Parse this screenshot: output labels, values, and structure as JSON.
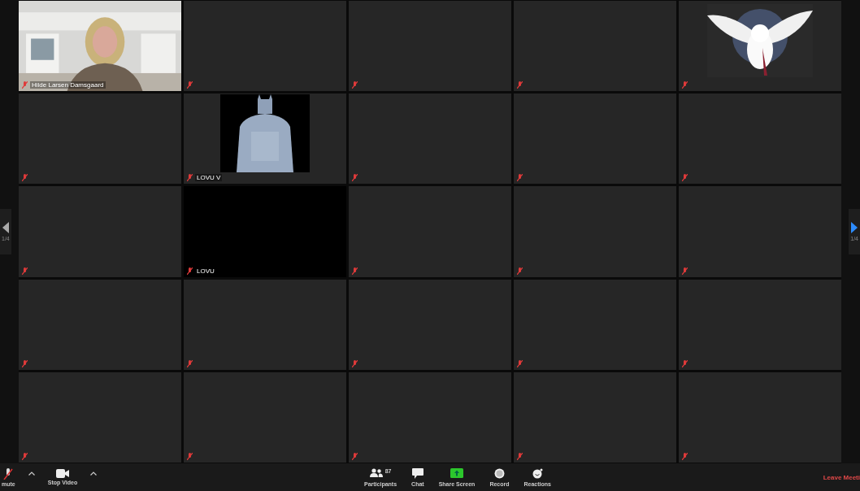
{
  "pager": {
    "left_label": "1/4",
    "right_label": "1/4"
  },
  "tiles": [
    {
      "kind": "video",
      "name": "Hilde Larsen Damsgaard",
      "muted": true
    },
    {
      "kind": "empty",
      "muted": true
    },
    {
      "kind": "empty",
      "muted": true
    },
    {
      "kind": "empty",
      "muted": true
    },
    {
      "kind": "avatar",
      "muted": true
    },
    {
      "kind": "empty",
      "muted": true
    },
    {
      "kind": "avatar",
      "name": "LOVU V",
      "muted": true
    },
    {
      "kind": "empty",
      "muted": true
    },
    {
      "kind": "empty",
      "muted": true
    },
    {
      "kind": "empty",
      "muted": true
    },
    {
      "kind": "empty",
      "muted": true
    },
    {
      "kind": "black",
      "name": "LOVU",
      "muted": true
    },
    {
      "kind": "empty",
      "muted": true
    },
    {
      "kind": "empty",
      "muted": true
    },
    {
      "kind": "empty",
      "muted": true
    },
    {
      "kind": "empty",
      "muted": true
    },
    {
      "kind": "empty",
      "muted": true
    },
    {
      "kind": "empty",
      "muted": true
    },
    {
      "kind": "empty",
      "muted": true
    },
    {
      "kind": "empty",
      "muted": true
    },
    {
      "kind": "empty",
      "muted": true
    },
    {
      "kind": "empty",
      "muted": true
    },
    {
      "kind": "empty",
      "muted": true
    },
    {
      "kind": "empty",
      "muted": true
    },
    {
      "kind": "empty",
      "muted": true
    }
  ],
  "toolbar": {
    "left": [
      {
        "kind": "mic",
        "label": "mute"
      },
      {
        "kind": "video",
        "label": "Stop Video"
      }
    ],
    "center": [
      {
        "kind": "participants",
        "label": "Participants",
        "count": "87"
      },
      {
        "kind": "chat",
        "label": "Chat"
      },
      {
        "kind": "share",
        "label": "Share Screen"
      },
      {
        "kind": "record",
        "label": "Record"
      },
      {
        "kind": "reactions",
        "label": "Reactions"
      }
    ],
    "leave": "Leave Meeti"
  }
}
